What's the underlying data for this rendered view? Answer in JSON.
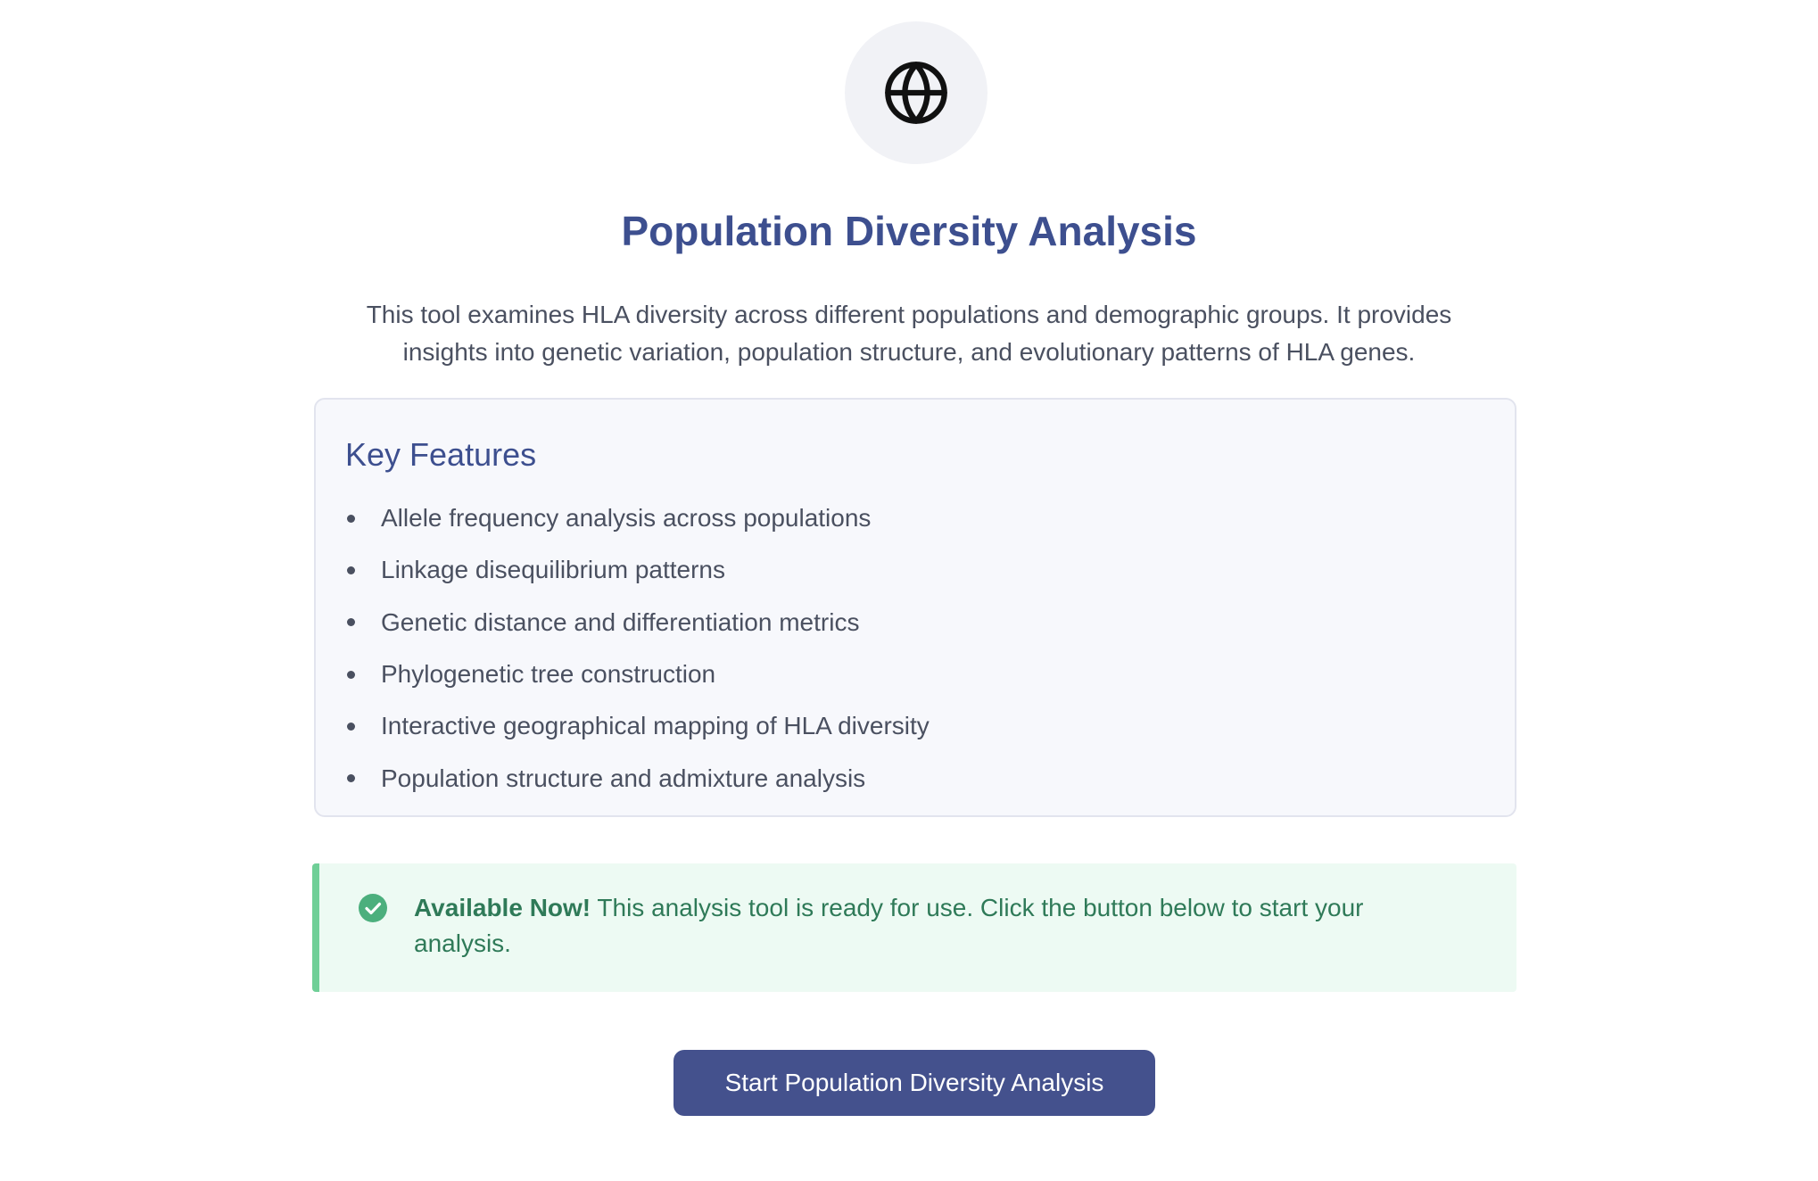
{
  "header": {
    "icon": "globe-icon",
    "title": "Population Diversity Analysis",
    "description": "This tool examines HLA diversity across different populations and demographic groups. It provides insights into genetic variation, population structure, and evolutionary patterns of HLA genes."
  },
  "features": {
    "title": "Key Features",
    "items": [
      "Allele frequency analysis across populations",
      "Linkage disequilibrium patterns",
      "Genetic distance and differentiation metrics",
      "Phylogenetic tree construction",
      "Interactive geographical mapping of HLA diversity",
      "Population structure and admixture analysis"
    ]
  },
  "status": {
    "icon": "check-circle-icon",
    "strong": "Available Now!",
    "text": "This analysis tool is ready for use. Click the button below to start your analysis."
  },
  "actions": {
    "start_label": "Start Population Diversity Analysis"
  },
  "colors": {
    "title": "#3d4f8f",
    "button": "#44518d",
    "status_background": "#edfaf3",
    "status_accent": "#6fcf97",
    "status_text": "#2f7a58"
  }
}
